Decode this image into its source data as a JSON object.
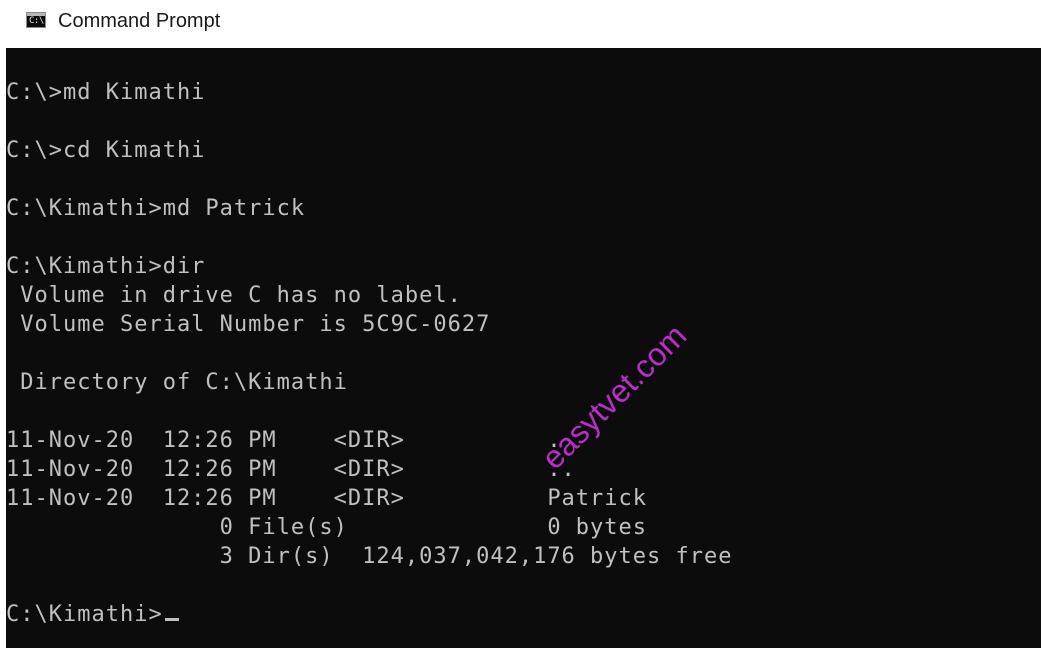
{
  "window": {
    "title": "Command Prompt",
    "icon": "console-icon",
    "icon_glyph": "C:\\."
  },
  "console": {
    "lines": [
      "C:\\>md Kimathi",
      "",
      "C:\\>cd Kimathi",
      "",
      "C:\\Kimathi>md Patrick",
      "",
      "C:\\Kimathi>dir",
      " Volume in drive C has no label.",
      " Volume Serial Number is 5C9C-0627",
      "",
      " Directory of C:\\Kimathi",
      "",
      "11-Nov-20  12:26 PM    <DIR>          .",
      "11-Nov-20  12:26 PM    <DIR>          ..",
      "11-Nov-20  12:26 PM    <DIR>          Patrick",
      "               0 File(s)              0 bytes",
      "               3 Dir(s)  124,037,042,176 bytes free",
      "",
      "C:\\Kimathi>"
    ],
    "background": "#0c0c0c",
    "foreground": "#c0c0c0"
  },
  "watermark": {
    "text": "easytvet.com",
    "color": "#c62fd4"
  }
}
